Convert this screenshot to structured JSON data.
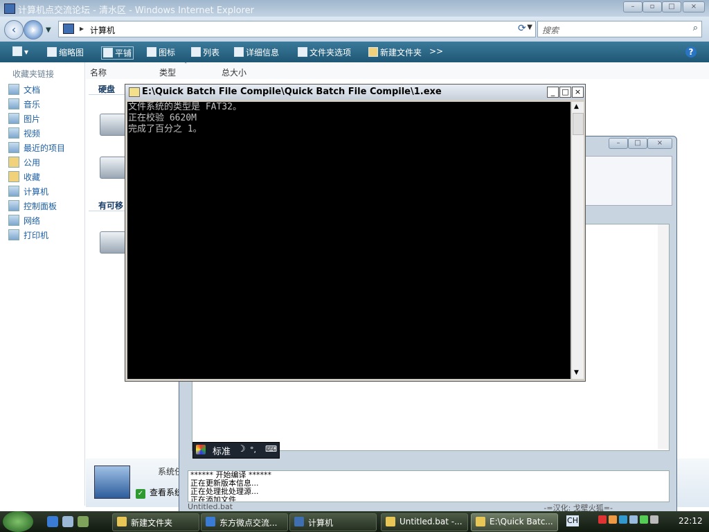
{
  "explorer": {
    "title": "计算机点交流论坛 - 清水区 - Windows Internet Explorer",
    "address": "计算机",
    "search_placeholder": "搜索",
    "toolbar": [
      "缩略图",
      "平铺",
      "图标",
      "列表",
      "详细信息",
      "文件夹选项",
      "新建文件夹"
    ],
    "toolbar_more": ">>",
    "favorites_header": "收藏夹链接",
    "favorites": [
      "文档",
      "音乐",
      "图片",
      "视频",
      "最近的项目",
      "公用",
      "收藏",
      "计算机",
      "控制面板",
      "网络",
      "打印机"
    ],
    "columns": [
      "名称",
      "类型",
      "总大小"
    ],
    "group_hdd": "硬盘",
    "group_removable": "有可移",
    "details_system": "系统任",
    "details_check": "查看系统"
  },
  "quickbatch": {
    "log": [
      "******  开始编译  ******",
      "正在更新版本信息...",
      "正在处理批处理源...",
      "正在添加文件"
    ],
    "status_file": "Untitled.bat",
    "status_credit": "-=汉化: 戈壁火狐=-"
  },
  "ime": {
    "mode": "标准",
    "moon": "☽",
    "punct": "°,",
    "kbd": "⌨"
  },
  "console": {
    "title": "E:\\Quick Batch File Compile\\Quick Batch File Compile\\1.exe",
    "lines": [
      "文件系统的类型是 FAT32。",
      "正在校验 6620M",
      "完成了百分之 1。"
    ]
  },
  "taskbar": {
    "tasks": [
      "新建文件夹",
      "东方微点交流...",
      "计算机",
      "Untitled.bat -...",
      "E:\\Quick Batc..."
    ],
    "active_index": 4,
    "language": "CH",
    "clock": "22:12"
  }
}
